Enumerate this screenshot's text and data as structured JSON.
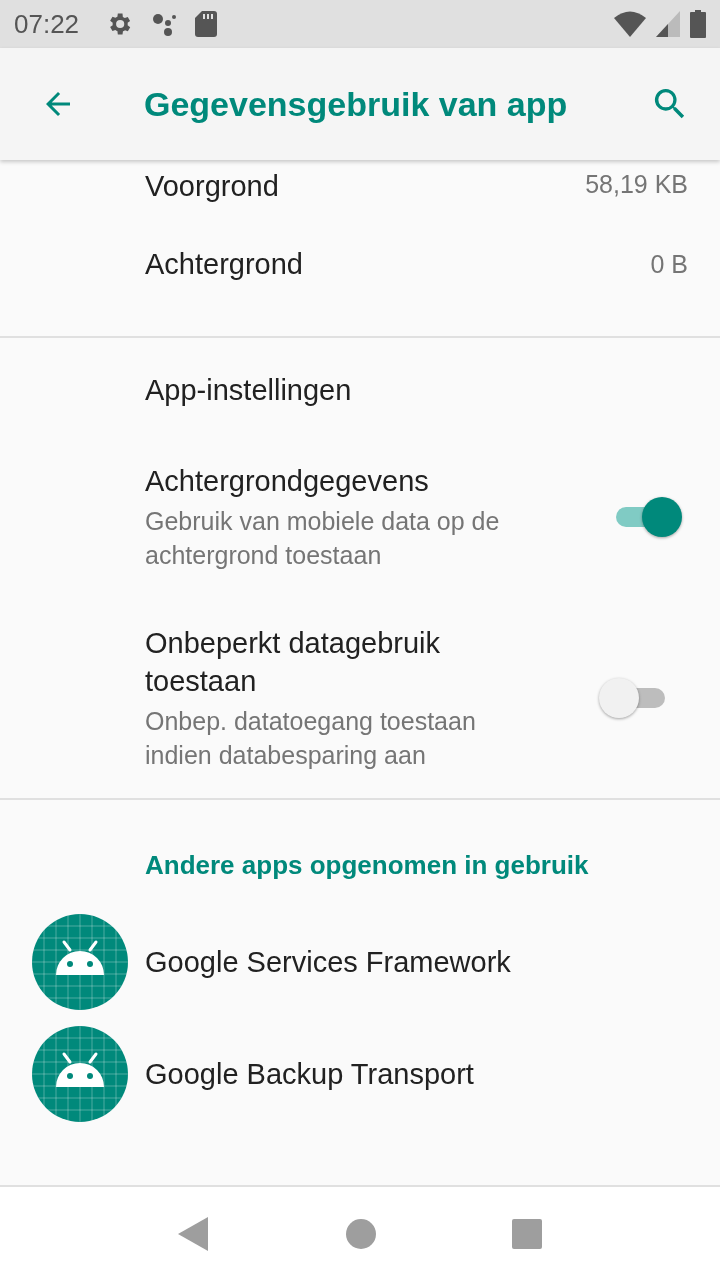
{
  "status_bar": {
    "time": "07:22"
  },
  "app_bar": {
    "title": "Gegevensgebruik van app"
  },
  "usage": [
    {
      "label": "Voorgrond",
      "value": "58,19  KB"
    },
    {
      "label": "Achtergrond",
      "value": "0 B"
    }
  ],
  "settings": {
    "header": "App-instellingen",
    "toggles": [
      {
        "title": "Achtergrondgegevens",
        "summary": "Gebruik van mobiele data op de achtergrond toestaan",
        "on": true
      },
      {
        "title": "Onbeperkt datagebruik toestaan",
        "summary": "Onbep. datatoegang toestaan indien databesparing aan",
        "on": false
      }
    ]
  },
  "other_apps": {
    "header": "Andere apps opgenomen in gebruik",
    "apps": [
      {
        "name": "Google Services Framework"
      },
      {
        "name": "Google Backup Transport"
      }
    ]
  }
}
